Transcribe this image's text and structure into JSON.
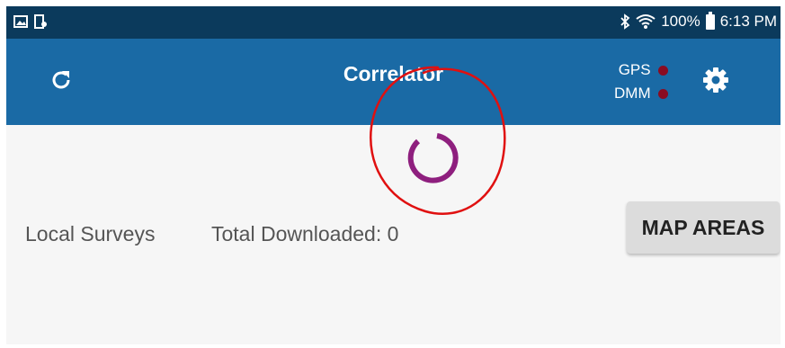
{
  "status_bar": {
    "battery_level": "100%",
    "time": "6:13 PM",
    "left_icons": [
      "gallery-icon",
      "notification-icon"
    ],
    "right_icons": [
      "bluetooth-icon",
      "wifi-icon",
      "battery-icon"
    ]
  },
  "app_bar": {
    "title": "Correlator",
    "refresh_icon": "refresh-icon",
    "settings_icon": "gear-icon",
    "indicators": [
      {
        "label": "GPS",
        "status_color": "#8a0c22"
      },
      {
        "label": "DMM",
        "status_color": "#8a0c22"
      }
    ],
    "background_color": "#1a6aa5"
  },
  "main": {
    "loading_spinner_color": "#8e1f7e",
    "local_surveys_label": "Local Surveys",
    "total_downloaded_label": "Total Downloaded: 0",
    "map_areas_button": "MAP AREAS"
  },
  "colors": {
    "status_bar": "#0b3a5c",
    "annotation_circle": "#e01010",
    "indicator_dot": "#8a0c22"
  }
}
